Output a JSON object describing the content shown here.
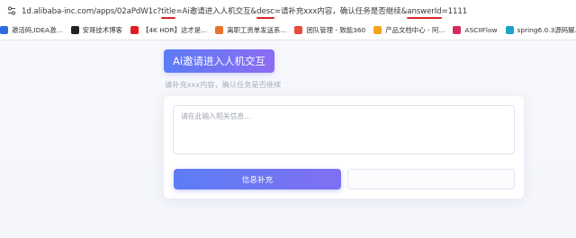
{
  "address_bar": {
    "url_parts": [
      {
        "text": "1d.alibaba-inc.com/apps/02aPdW1c?",
        "param": false
      },
      {
        "text": "title",
        "param": true
      },
      {
        "text": "=Ai邀请进入人机交互&",
        "param": false
      },
      {
        "text": "desc",
        "param": true
      },
      {
        "text": "=请补充xxx内容，确认任务是否继续&",
        "param": false
      },
      {
        "text": "answerId",
        "param": true
      },
      {
        "text": "=1111",
        "param": false
      }
    ]
  },
  "bookmarks": [
    {
      "label": "邀活码,IDEA激...",
      "color": "#2b6de0"
    },
    {
      "label": "安哥技术博客",
      "color": "#222222"
    },
    {
      "label": "【4K HDR】这才是...",
      "color": "#e02020"
    },
    {
      "label": "离职工资单发送系...",
      "color": "#e8742a"
    },
    {
      "label": "团队管理 - 致能360",
      "color": "#e64b3c"
    },
    {
      "label": "产品文档中心 - 阿...",
      "color": "#f2a51c"
    },
    {
      "label": "ASCIIFlow",
      "color": "#d12c5a"
    },
    {
      "label": "spring6.0.3源码解...",
      "color": "#1aa5c8"
    }
  ],
  "content": {
    "title": "Ai邀请进入人机交互",
    "description": "请补充xxx内容，确认任务是否继续",
    "input_placeholder": "请在此输入相关信息...",
    "primary_button": "信息补充",
    "secondary_button": ""
  },
  "colors": {
    "accent_start": "#5c7df4",
    "accent_end": "#8c6cf3",
    "url_underline": "#d9262c"
  }
}
